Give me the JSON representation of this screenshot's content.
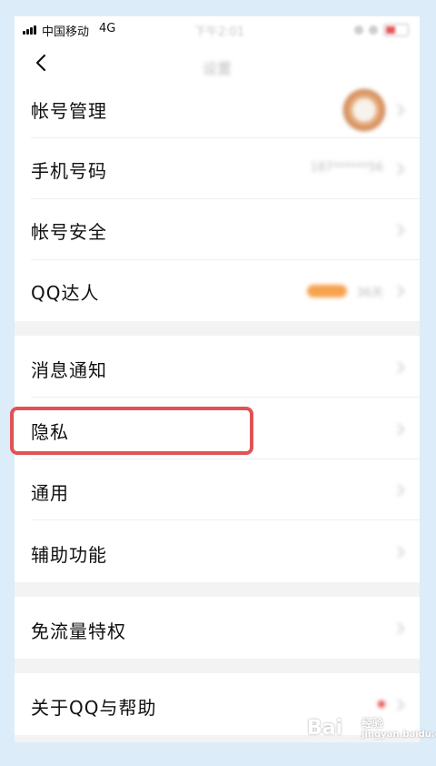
{
  "status_bar": {
    "carrier": "中国移动",
    "network": "4G",
    "time": "下午2:01"
  },
  "nav": {
    "title": "设置"
  },
  "settings": {
    "account_management": "帐号管理",
    "phone_number": "手机号码",
    "phone_value": "187******56",
    "account_security": "帐号安全",
    "qq_expert": "QQ达人",
    "qq_expert_value": "36天",
    "notifications": "消息通知",
    "privacy": "隐私",
    "general": "通用",
    "accessibility": "辅助功能",
    "free_data": "免流量特权",
    "about_help": "关于QQ与帮助"
  },
  "watermark": {
    "brand": "Bai",
    "site": "经验",
    "url": "jingyan.baidu.com"
  },
  "colors": {
    "highlight": "#e05355",
    "badge": "#f6a24f",
    "background": "#dcecf8"
  }
}
